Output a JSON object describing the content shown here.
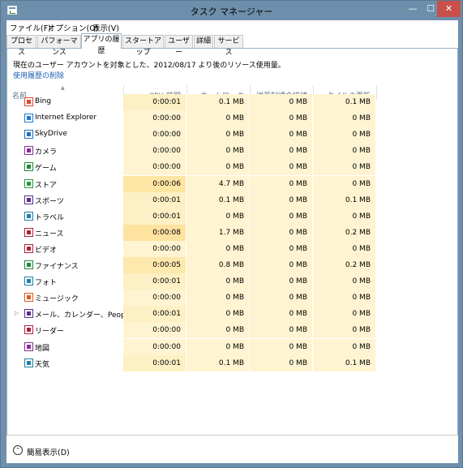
{
  "window": {
    "title": "タスク マネージャー",
    "minimize_glyph": "—",
    "maximize_glyph": "☐",
    "close_glyph": "✕",
    "accent": "#6d8fab",
    "close_color": "#c7504b"
  },
  "menu": [
    {
      "label": "ファイル(F)"
    },
    {
      "label": "オプション(O)"
    },
    {
      "label": "表示(V)"
    }
  ],
  "tabs": [
    {
      "label": "プロセス"
    },
    {
      "label": "パフォーマンス"
    },
    {
      "label": "アプリの履歴",
      "active": true
    },
    {
      "label": "スタートアップ"
    },
    {
      "label": "ユーザー"
    },
    {
      "label": "詳細"
    },
    {
      "label": "サービス"
    }
  ],
  "description": "現在のユーザー アカウントを対象とした、2012/08/17 より後のリソース使用量。",
  "delete_history_link": "使用履歴の削除",
  "columns": {
    "name": "名前",
    "cpu": "CPU 時間",
    "network": "ネットワーク",
    "metered": "従量制課金接続",
    "tile": "タイルの更新"
  },
  "rows": [
    {
      "name": "Bing",
      "icon": "bing-icon",
      "icon_color": "#e8452c",
      "cpu": "0:00:01",
      "net": "0.1 MB",
      "metered": "0 MB",
      "tile": "0.1 MB",
      "cpu_heat": "#fdf0c4"
    },
    {
      "name": "Internet Explorer",
      "icon": "ie-icon",
      "icon_color": "#1f7bd8",
      "cpu": "0:00:00",
      "net": "0 MB",
      "metered": "0 MB",
      "tile": "0 MB",
      "cpu_heat": "#fff4d1"
    },
    {
      "name": "SkyDrive",
      "icon": "skydrive-icon",
      "icon_color": "#1f6fc4",
      "cpu": "0:00:00",
      "net": "0 MB",
      "metered": "0 MB",
      "tile": "0 MB",
      "cpu_heat": "#fff4d1"
    },
    {
      "name": "カメラ",
      "icon": "camera-icon",
      "icon_color": "#8a2d9a",
      "cpu": "0:00:00",
      "net": "0 MB",
      "metered": "0 MB",
      "tile": "0 MB",
      "cpu_heat": "#fff4d1"
    },
    {
      "name": "ゲーム",
      "icon": "games-icon",
      "icon_color": "#1e8a35",
      "cpu": "0:00:00",
      "net": "0 MB",
      "metered": "0 MB",
      "tile": "0 MB",
      "cpu_heat": "#fff4d1"
    },
    {
      "name": "ストア",
      "icon": "store-icon",
      "icon_color": "#2a9a3b",
      "cpu": "0:00:06",
      "net": "4.7 MB",
      "metered": "0 MB",
      "tile": "0 MB",
      "cpu_heat": "#fde6a3"
    },
    {
      "name": "スポーツ",
      "icon": "sports-icon",
      "icon_color": "#5a2d8f",
      "cpu": "0:00:01",
      "net": "0.1 MB",
      "metered": "0 MB",
      "tile": "0.1 MB",
      "cpu_heat": "#fdf0c4"
    },
    {
      "name": "トラベル",
      "icon": "travel-icon",
      "icon_color": "#1e7fa6",
      "cpu": "0:00:01",
      "net": "0 MB",
      "metered": "0 MB",
      "tile": "0 MB",
      "cpu_heat": "#fdf0c4"
    },
    {
      "name": "ニュース",
      "icon": "news-icon",
      "icon_color": "#b0223a",
      "cpu": "0:00:08",
      "net": "1.7 MB",
      "metered": "0 MB",
      "tile": "0.2 MB",
      "cpu_heat": "#fde2a0"
    },
    {
      "name": "ビデオ",
      "icon": "video-icon",
      "icon_color": "#b0223a",
      "cpu": "0:00:00",
      "net": "0 MB",
      "metered": "0 MB",
      "tile": "0 MB",
      "cpu_heat": "#fff4d1"
    },
    {
      "name": "ファイナンス",
      "icon": "finance-icon",
      "icon_color": "#1e8a35",
      "cpu": "0:00:05",
      "net": "0.8 MB",
      "metered": "0 MB",
      "tile": "0.2 MB",
      "cpu_heat": "#fde8ad"
    },
    {
      "name": "フォト",
      "icon": "photos-icon",
      "icon_color": "#1e7fa6",
      "cpu": "0:00:01",
      "net": "0 MB",
      "metered": "0 MB",
      "tile": "0 MB",
      "cpu_heat": "#fdf0c4"
    },
    {
      "name": "ミュージック",
      "icon": "music-icon",
      "icon_color": "#e05a1f",
      "cpu": "0:00:00",
      "net": "0 MB",
      "metered": "0 MB",
      "tile": "0 MB",
      "cpu_heat": "#fff4d1"
    },
    {
      "name": "メール、カレンダー、People...",
      "icon": "mail-icon",
      "icon_color": "#5a2d8f",
      "cpu": "0:00:01",
      "net": "0 MB",
      "metered": "0 MB",
      "tile": "0 MB",
      "cpu_heat": "#fdf0c4",
      "expandable": true
    },
    {
      "name": "リーダー",
      "icon": "reader-icon",
      "icon_color": "#b0223a",
      "cpu": "0:00:00",
      "net": "0 MB",
      "metered": "0 MB",
      "tile": "0 MB",
      "cpu_heat": "#fff4d1"
    },
    {
      "name": "地図",
      "icon": "maps-icon",
      "icon_color": "#8a2d9a",
      "cpu": "0:00:00",
      "net": "0 MB",
      "metered": "0 MB",
      "tile": "0 MB",
      "cpu_heat": "#fff4d1"
    },
    {
      "name": "天気",
      "icon": "weather-icon",
      "icon_color": "#1e7fa6",
      "cpu": "0:00:01",
      "net": "0.1 MB",
      "metered": "0 MB",
      "tile": "0.1 MB",
      "cpu_heat": "#fdf0c4"
    }
  ],
  "footer": {
    "fewer_details_label": "簡易表示(D)",
    "fewer_details_glyph": "⌃"
  },
  "colors": {
    "column_bg": "#fff4d1",
    "link": "#1a5fb4"
  }
}
